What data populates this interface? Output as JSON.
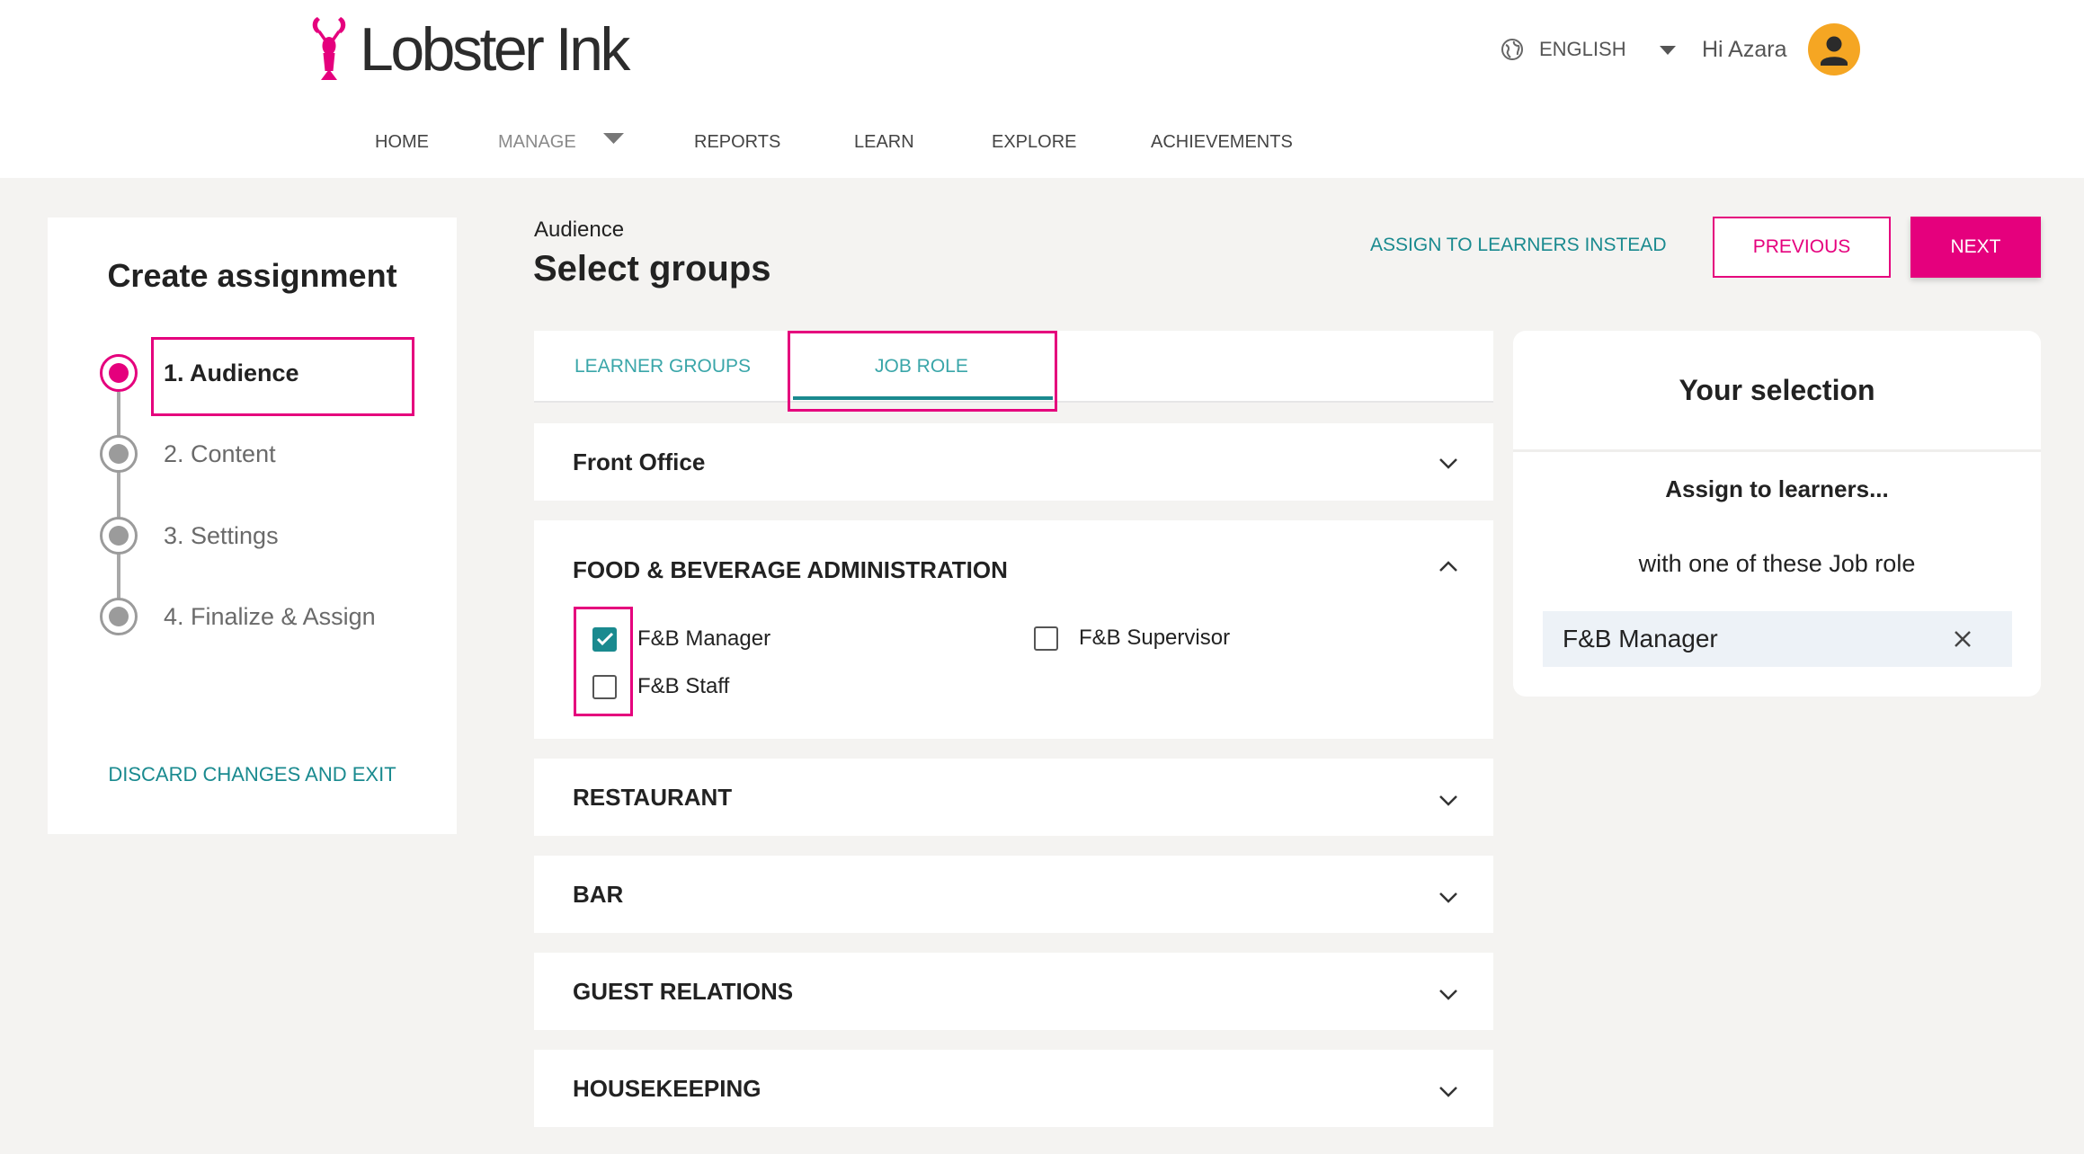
{
  "brand": {
    "logo_text": "Lobster Ink",
    "logo_icon": "lobster-icon",
    "accent_color": "#e5007d",
    "teal_color": "#1a8a8f"
  },
  "header": {
    "language": {
      "icon": "globe-icon",
      "label": "ENGLISH",
      "dropdown_icon": "caret-down-icon"
    },
    "user": {
      "greeting": "Hi Azara",
      "avatar_icon": "avatar-icon",
      "avatar_color": "#f5a623"
    }
  },
  "nav": {
    "items": [
      {
        "label": "HOME"
      },
      {
        "label": "MANAGE",
        "has_dropdown": true
      },
      {
        "label": "REPORTS"
      },
      {
        "label": "LEARN"
      },
      {
        "label": "EXPLORE"
      },
      {
        "label": "ACHIEVEMENTS"
      }
    ]
  },
  "sidebar": {
    "title": "Create assignment",
    "steps": [
      {
        "label": "1. Audience",
        "active": true
      },
      {
        "label": "2. Content",
        "active": false
      },
      {
        "label": "3. Settings",
        "active": false
      },
      {
        "label": "4. Finalize & Assign",
        "active": false
      }
    ],
    "discard_label": "DISCARD CHANGES AND EXIT"
  },
  "main": {
    "eyebrow": "Audience",
    "title": "Select groups",
    "assign_to_learners_label": "ASSIGN TO LEARNERS INSTEAD",
    "previous_label": "PREVIOUS",
    "next_label": "NEXT",
    "tabs": [
      {
        "label": "LEARNER GROUPS",
        "selected": false
      },
      {
        "label": "JOB ROLE",
        "selected": true
      }
    ],
    "groups": [
      {
        "title": "Front Office",
        "expanded": false,
        "icon": "chevron-down-icon"
      },
      {
        "title": "FOOD & BEVERAGE ADMINISTRATION",
        "expanded": true,
        "icon": "chevron-up-icon",
        "roles": [
          {
            "label": "F&B Manager",
            "checked": true
          },
          {
            "label": "F&B Supervisor",
            "checked": false
          },
          {
            "label": "F&B Staff",
            "checked": false
          }
        ]
      },
      {
        "title": "RESTAURANT",
        "expanded": false,
        "icon": "chevron-down-icon"
      },
      {
        "title": "BAR",
        "expanded": false,
        "icon": "chevron-down-icon"
      },
      {
        "title": "GUEST RELATIONS",
        "expanded": false,
        "icon": "chevron-down-icon"
      },
      {
        "title": "HOUSEKEEPING",
        "expanded": false,
        "icon": "chevron-down-icon"
      }
    ]
  },
  "selection": {
    "title": "Your selection",
    "subtitle": "Assign to learners...",
    "description": "with one of these Job role",
    "chips": [
      {
        "label": "F&B Manager",
        "remove_icon": "close-icon"
      }
    ]
  }
}
